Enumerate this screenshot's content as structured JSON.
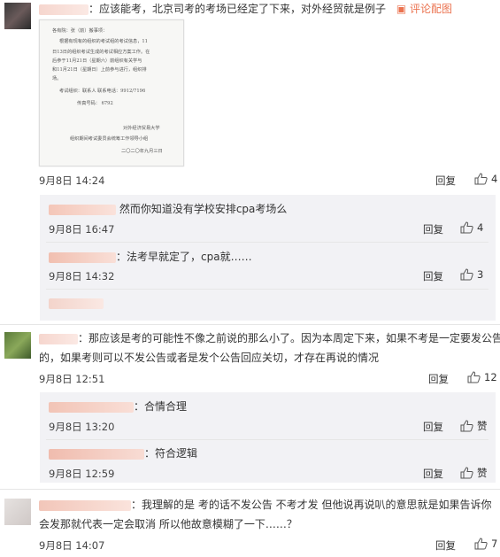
{
  "comments": [
    {
      "text": "：应该能考，北京司考的考场已经定了下来，对外经贸就是例子",
      "comment_link": "评论配图",
      "time": "9月8日 14:24",
      "reply_label": "回复",
      "likes": "4",
      "image_lines": [
        "各有院：张（前）搬事项：",
        "根据有现有的组织的考试组的考试信息，11",
        "日13日的组织考试生成的考试相应方案工作。在",
        "后参于11月21日（星期六）前组织有关学与",
        "和11月21日（星期日）上前参与进行，组织排",
        "场。",
        "考试组织：联系人    联系电话：9912/7196",
        "传真号码：        6792",
        "对外经济贸易大学",
        "组织期间考试委员会统筹工作领导小组",
        "二〇二〇年九月三日"
      ],
      "replies": [
        {
          "text": "然而你知道没有学校安排cpa考场么",
          "time": "9月8日 16:47",
          "reply_label": "回复",
          "likes": "4"
        },
        {
          "text": "：法考早就定了，cpa就……",
          "time": "9月8日 14:32",
          "reply_label": "回复",
          "likes": "3"
        }
      ]
    },
    {
      "text_line1": "：那应该是考的可能性不像之前说的那么小了。因为本周定下来，如果不考是一定要发公告",
      "text_line2": "的，如果考则可以不发公告或者是发个公告回应关切，才存在再说的情况",
      "time": "9月8日 12:51",
      "reply_label": "回复",
      "likes": "12",
      "replies": [
        {
          "text": "：合情合理",
          "time": "9月8日 13:20",
          "reply_label": "回复",
          "likes": "赞"
        },
        {
          "text": "：符合逻辑",
          "time": "9月8日 12:59",
          "reply_label": "回复",
          "likes": "赞"
        }
      ]
    },
    {
      "text_line1": "：我理解的是 考的话不发公告 不考才发 但他说再说叭的意思就是如果告诉你",
      "text_line2": "会发那就代表一定会取消 所以他故意模糊了一下……？",
      "time": "9月8日 14:07",
      "reply_label": "回复",
      "likes": "7"
    }
  ],
  "colors": {
    "username": "#eb7350",
    "link": "#eb7350",
    "reply_bg": "#f2f2f5"
  }
}
